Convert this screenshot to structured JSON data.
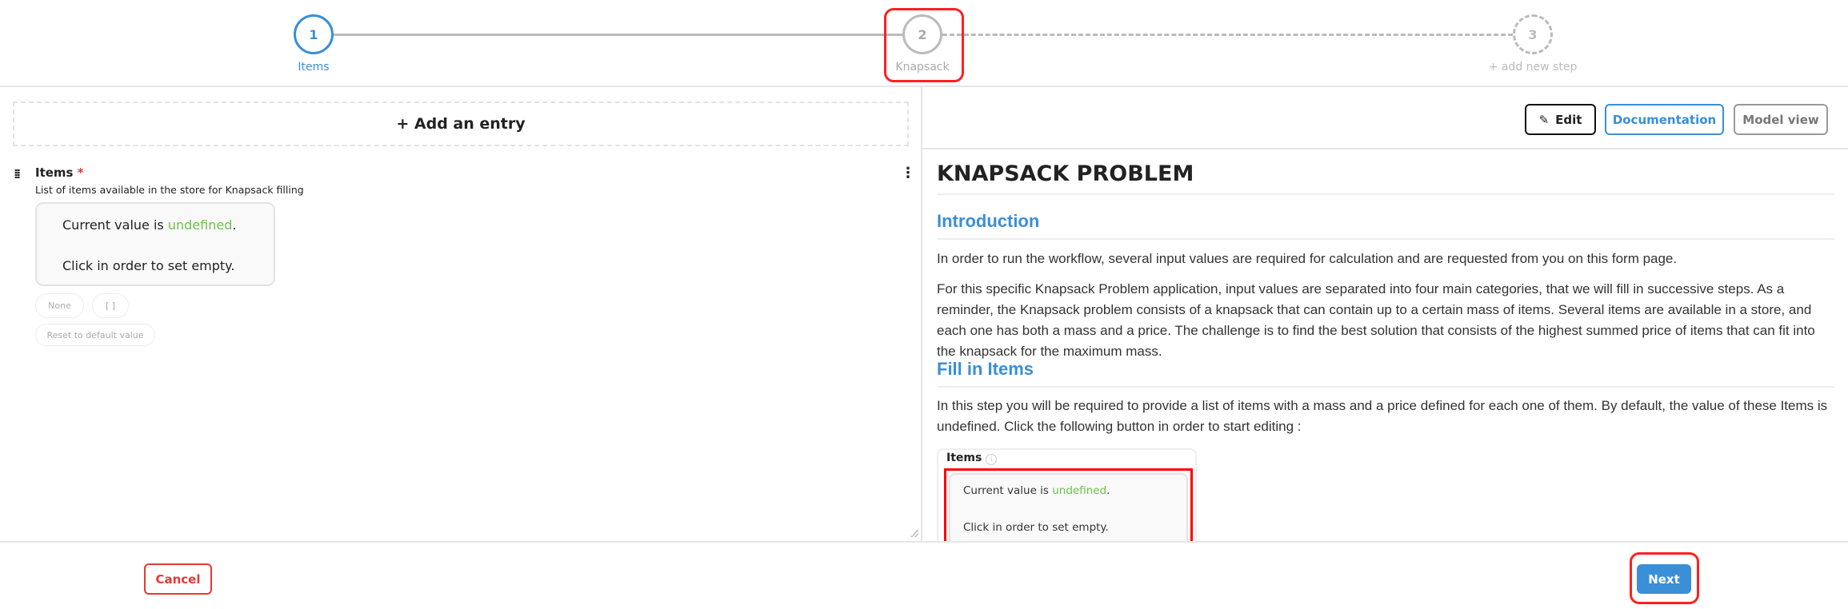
{
  "stepper": {
    "steps": [
      {
        "number": "1",
        "label": "Items",
        "state": "active"
      },
      {
        "number": "2",
        "label": "Knapsack",
        "state": "pending"
      },
      {
        "number": "3",
        "label": "+ add new step",
        "state": "new"
      }
    ]
  },
  "left": {
    "add_entry": "+ Add an entry",
    "field": {
      "label": "Items",
      "required_mark": "*",
      "description": "List of items available in the store for Knapsack filling",
      "value_prefix": "Current value is ",
      "value": "undefined",
      "value_suffix": ".",
      "hint": "Click in order to set empty.",
      "buttons": {
        "none": "None",
        "empty_list": "[ ]",
        "reset": "Reset to default value"
      }
    }
  },
  "right": {
    "toolbar": {
      "edit": "Edit",
      "documentation": "Documentation",
      "model_view": "Model view"
    },
    "doc": {
      "title": "KNAPSACK PROBLEM",
      "intro_heading": "Introduction",
      "intro_p1": "In order to run the workflow, several input values are required for calculation and are requested from you on this form page.",
      "intro_p2": "For this specific Knapsack Problem application, input values are separated into four main categories, that we will fill in successive steps. As a reminder, the Knapsack problem consists of a knapsack that can contain up to a certain mass of items. Several items are available in a store, and each one has both a mass and a price. The challenge is to find the best solution that consists of the highest summed price of items that can fit into the knapsack for the maximum mass.",
      "fill_heading": "Fill in Items",
      "fill_p": "In this step you will be required to provide a list of items with a mass and a price defined for each one of them. By default, the value of these Items is undefined. Click the following button in order to start editing :",
      "image": {
        "label": "Items",
        "value_prefix": "Current value is ",
        "value": "undefined",
        "value_suffix": ".",
        "hint": "Click in order to set empty."
      }
    }
  },
  "footer": {
    "cancel": "Cancel",
    "next": "Next"
  },
  "colors": {
    "accent": "#3a8fd6",
    "green": "#6cc04a",
    "danger": "#e53935",
    "highlight": "#ff2020"
  }
}
